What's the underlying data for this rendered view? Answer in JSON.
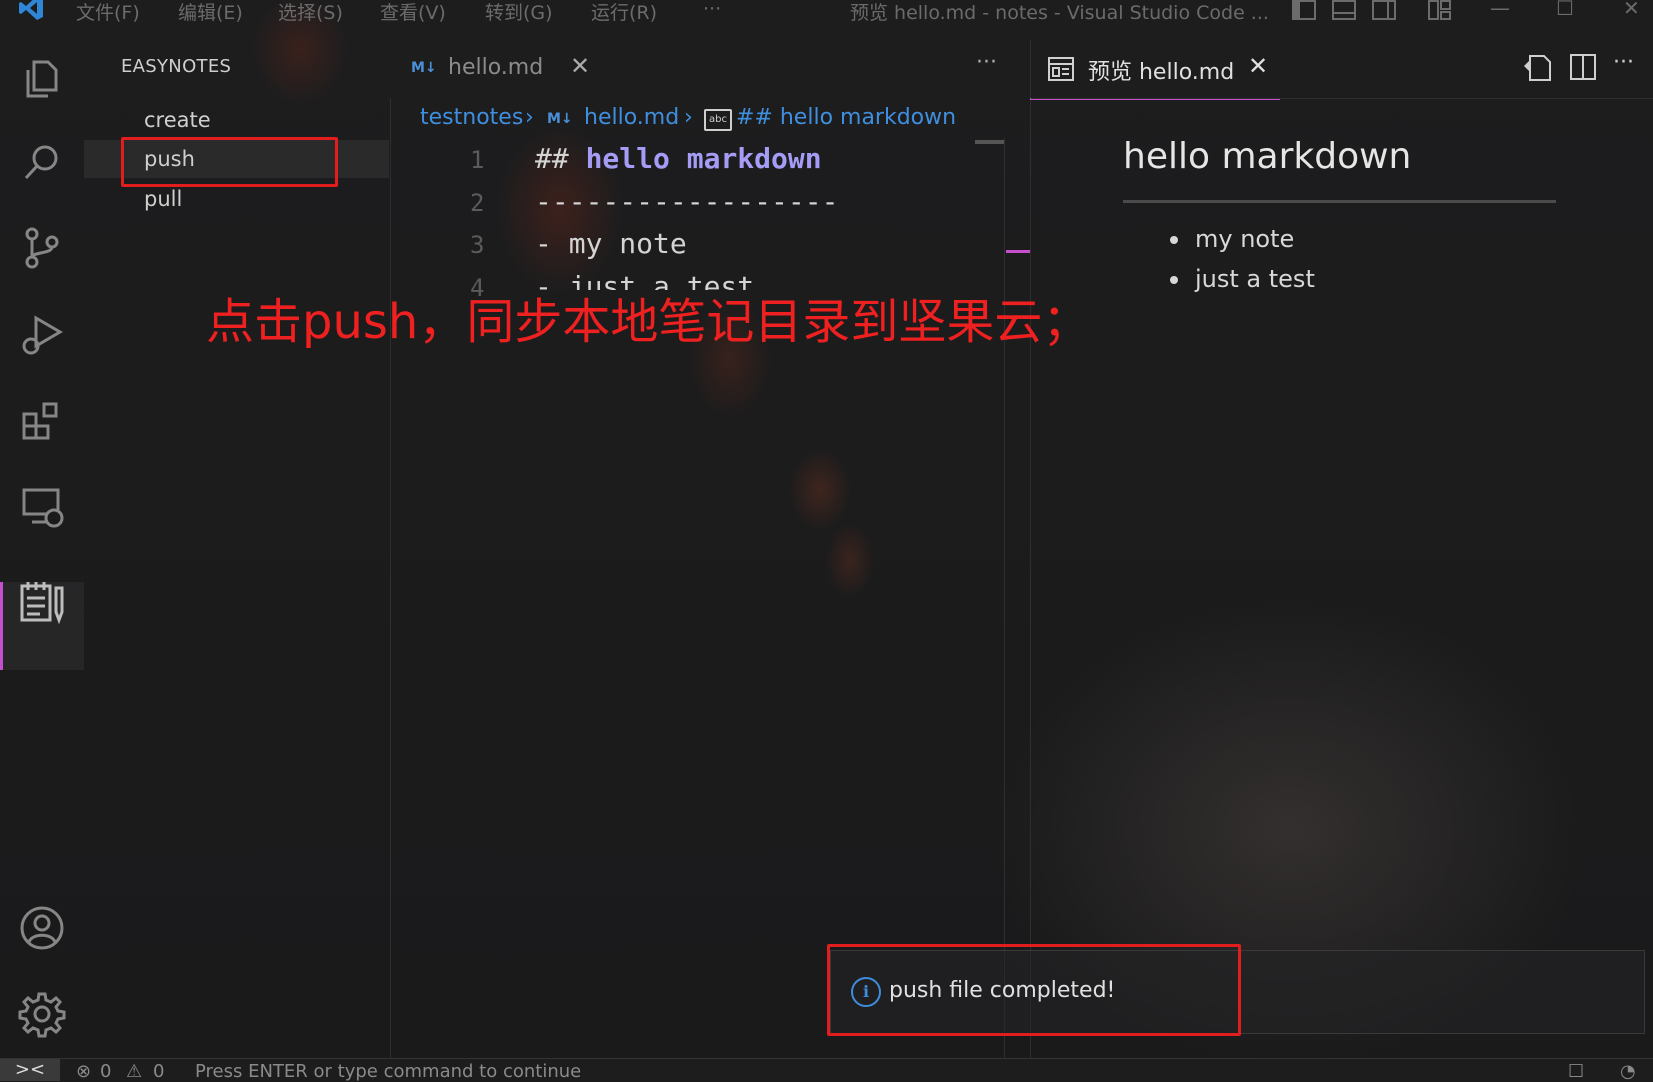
{
  "titlebar": {
    "menus": [
      "文件(F)",
      "编辑(E)",
      "选择(S)",
      "查看(V)",
      "转到(G)",
      "运行(R)",
      "···"
    ],
    "window_title": "预览 hello.md - notes - Visual Studio Code ...",
    "controls": [
      "—",
      "☐",
      "✕"
    ]
  },
  "sidebar": {
    "title": "EASYNOTES",
    "items": [
      {
        "label": "create"
      },
      {
        "label": "push"
      },
      {
        "label": "pull"
      }
    ]
  },
  "editor": {
    "tab_icon": "M↓",
    "tab_label": "hello.md",
    "more": "···",
    "breadcrumb": {
      "folder": "testnotes",
      "file_icon": "M↓",
      "file": "hello.md",
      "symbol_icon": "abc",
      "symbol": "## hello markdown"
    },
    "lines": [
      {
        "no": "1",
        "hash": "## ",
        "heading": "hello markdown"
      },
      {
        "no": "2",
        "text": "------------------"
      },
      {
        "no": "3",
        "text": "- my note"
      },
      {
        "no": "4",
        "text": "- just a test"
      }
    ]
  },
  "preview": {
    "tab_label": "预览 hello.md",
    "more": "···",
    "heading": "hello markdown",
    "bullets": [
      "my note",
      "just a test"
    ]
  },
  "annotation": {
    "text": "点击push，同步本地笔记目录到坚果云；",
    "color": "#ef2020"
  },
  "notification": {
    "icon": "i",
    "message": "push file completed!"
  },
  "statusbar": {
    "remote_icon": "><",
    "errors": "0",
    "warnings": "0",
    "message": "Press ENTER or type command to continue"
  },
  "colors": {
    "accent": "#c74fce",
    "link": "#3f8fde",
    "highlight_box": "#e21d1d"
  }
}
